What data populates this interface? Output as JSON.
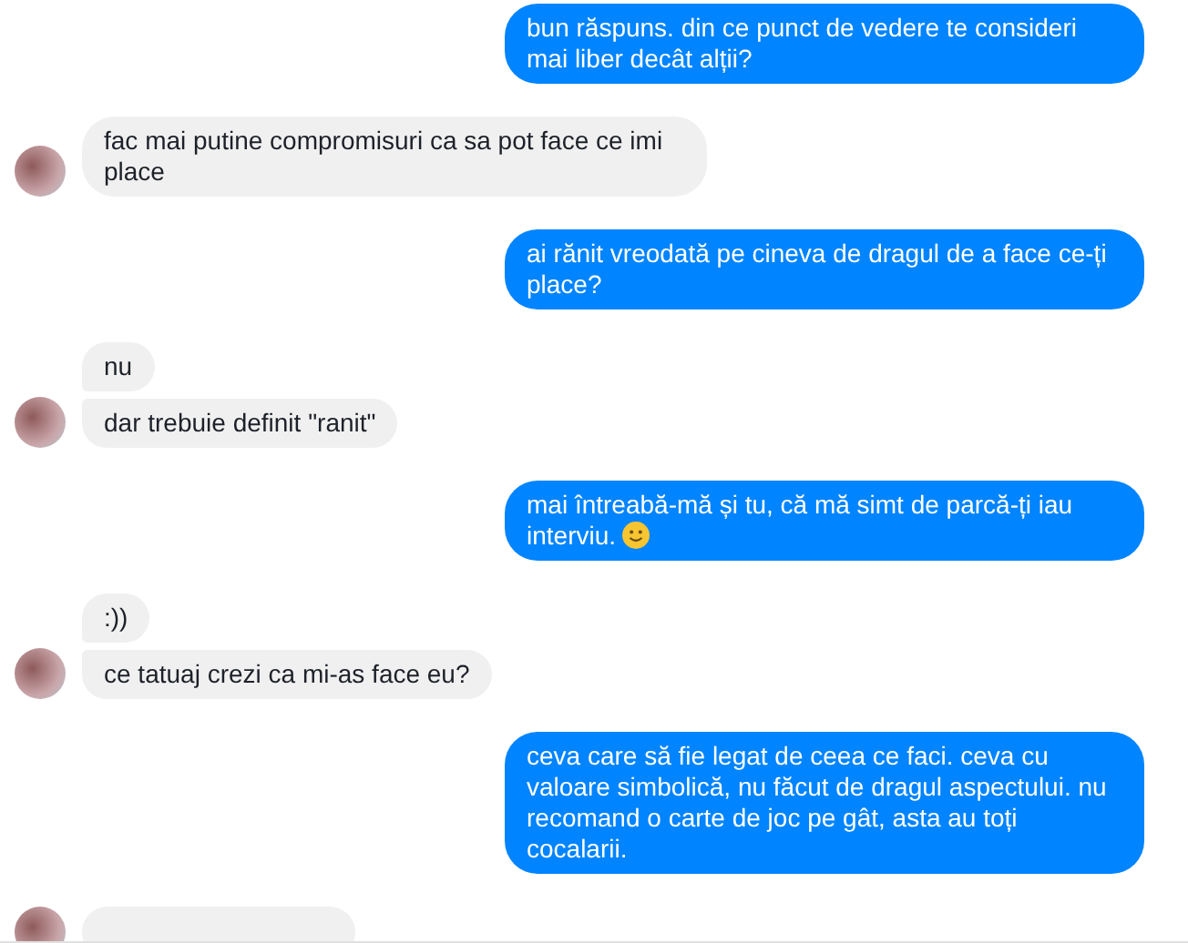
{
  "messages": [
    {
      "kind": "outgoing",
      "bubbles": [
        {
          "kind": "plain",
          "text": "bun răspuns. din ce punct de vedere te consideri mai liber decât alții?"
        }
      ]
    },
    {
      "kind": "incoming",
      "bubbles": [
        {
          "kind": "plain",
          "text": "fac mai putine compromisuri ca sa pot face ce imi place"
        }
      ]
    },
    {
      "kind": "outgoing",
      "bubbles": [
        {
          "kind": "plain",
          "text": "ai rănit vreodată pe cineva de dragul de a face ce-ți place?"
        }
      ]
    },
    {
      "kind": "incoming",
      "bubbles": [
        {
          "kind": "plain",
          "text": "nu"
        },
        {
          "kind": "plain",
          "text": "dar trebuie definit \"ranit\""
        }
      ]
    },
    {
      "kind": "outgoing",
      "bubbles": [
        {
          "kind": "smiley",
          "text": "mai întreabă-mă și tu, că mă simt de parcă-ți iau interviu."
        }
      ]
    },
    {
      "kind": "incoming",
      "bubbles": [
        {
          "kind": "plain",
          "text": ":))"
        },
        {
          "kind": "plain",
          "text": "ce tatuaj crezi ca mi-as face eu?"
        }
      ]
    },
    {
      "kind": "outgoing",
      "bubbles": [
        {
          "kind": "plain",
          "text": "ceva care să fie legat de ceea ce faci. ceva cu valoare simbolică, nu făcut de dragul aspectului. nu recomand o carte de joc pe gât, asta au toți cocalarii."
        }
      ]
    }
  ]
}
